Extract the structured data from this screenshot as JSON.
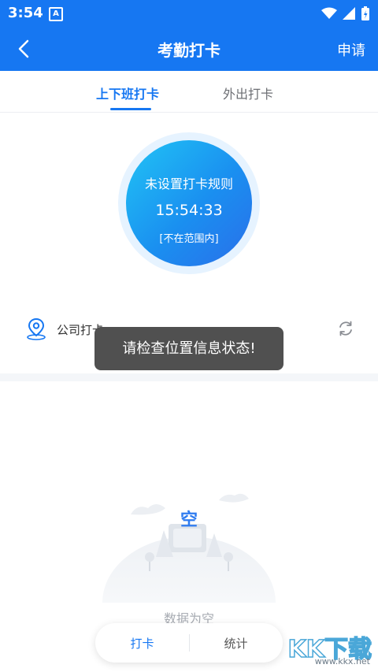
{
  "status_bar": {
    "time": "3:54",
    "notification_badge": "A"
  },
  "app_bar": {
    "title": "考勤打卡",
    "action_label": "申请"
  },
  "tabs": [
    {
      "label": "上下班打卡",
      "active": true
    },
    {
      "label": "外出打卡",
      "active": false
    }
  ],
  "clock": {
    "rule_text": "未设置打卡规则",
    "time": "15:54:33",
    "range_text": "[不在范围内]"
  },
  "location": {
    "label": "公司打卡"
  },
  "toast": {
    "message": "请检查位置信息状态!"
  },
  "empty_state": {
    "illustration_char": "空",
    "text": "数据为空"
  },
  "bottom_nav": {
    "punch_label": "打卡",
    "stats_label": "统计"
  },
  "watermark": {
    "main": "KK下载",
    "url": "www.kkx.net"
  },
  "colors": {
    "primary": "#1677f2",
    "toast_bg": "#505050",
    "muted_text": "#a8acb3"
  }
}
